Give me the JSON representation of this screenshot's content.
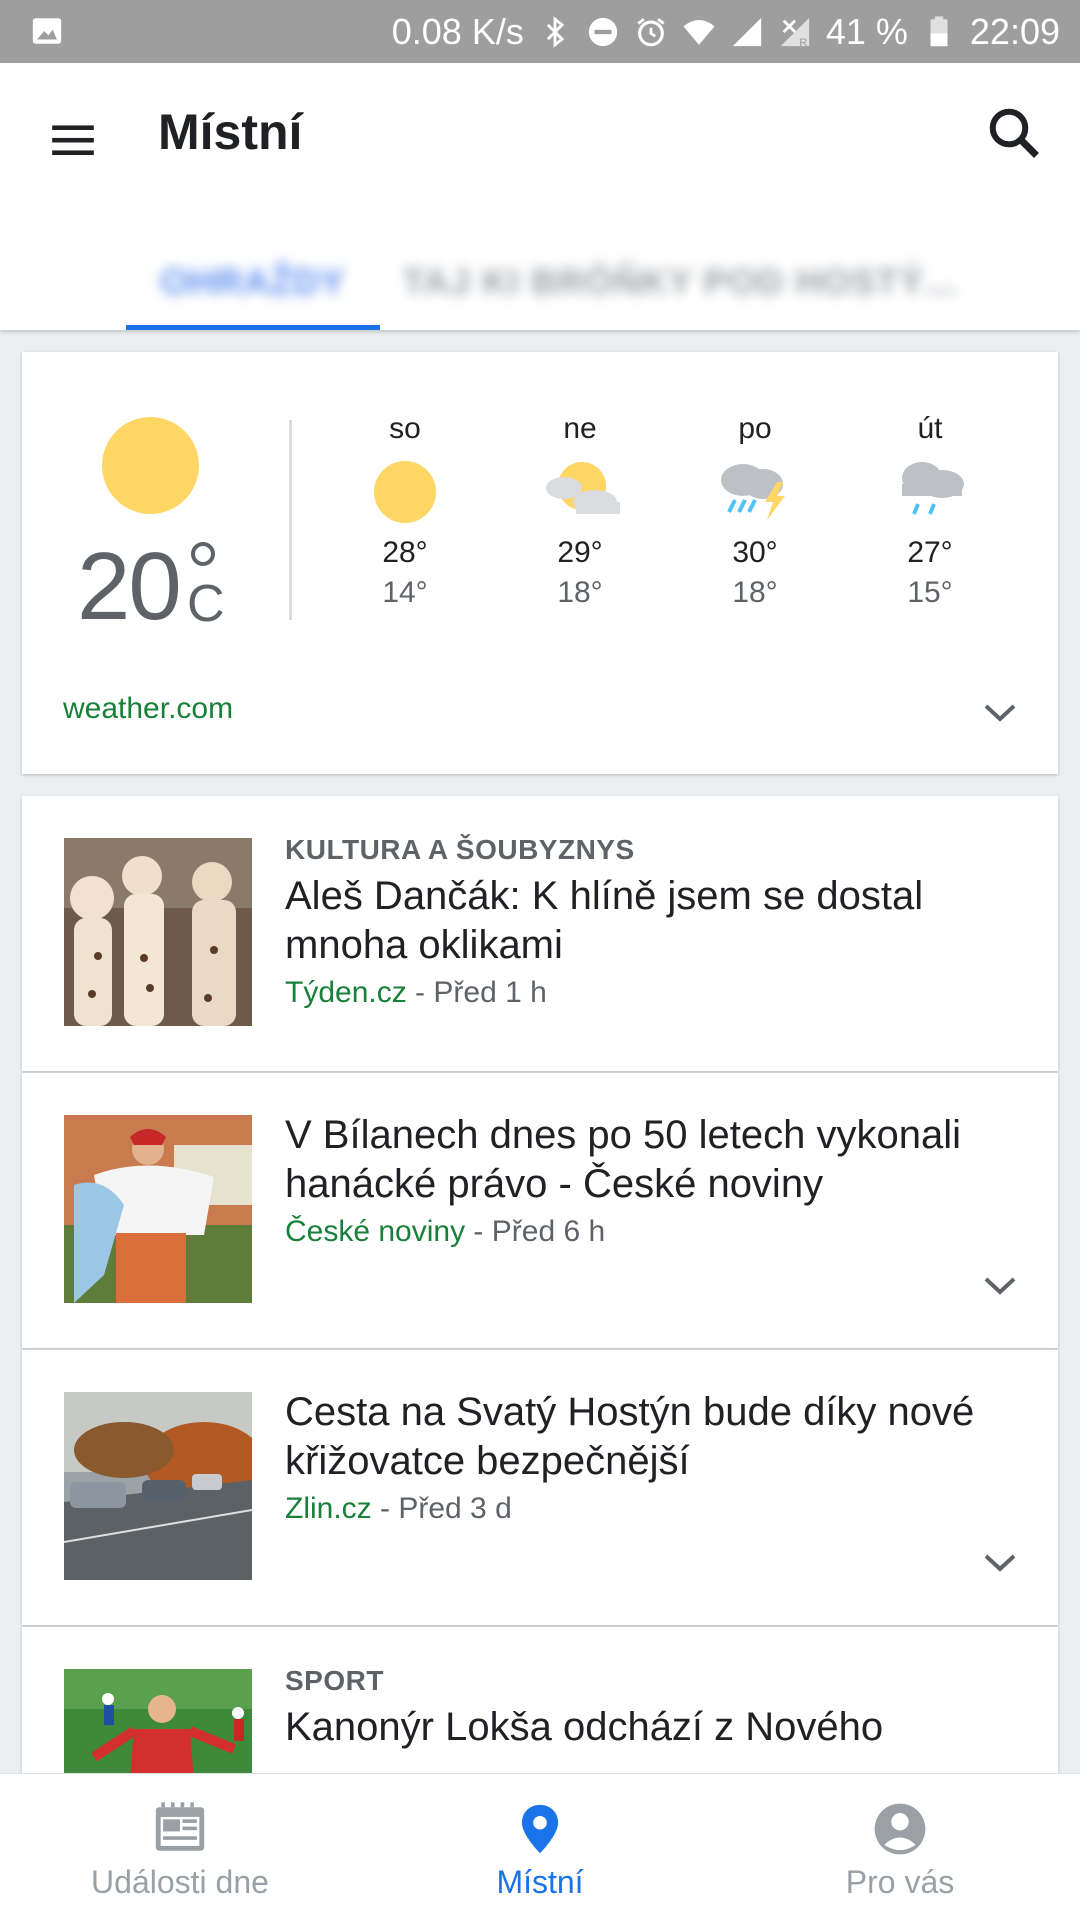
{
  "status_bar": {
    "speed": "0.08 K/s",
    "battery": "41 %",
    "time": "22:09",
    "icons": [
      "image-icon",
      "bluetooth-icon",
      "do-not-disturb-icon",
      "alarm-icon",
      "wifi-icon",
      "signal-icon",
      "signal-roaming-icon",
      "battery-icon"
    ]
  },
  "app_bar": {
    "title": "Místní",
    "tabs": [
      {
        "label": "OHRAŽDY",
        "selected": true
      },
      {
        "label": "TAJ KI BRÖŇKY POD HOSTÝ...",
        "selected": false
      }
    ]
  },
  "weather": {
    "current_temp": "20",
    "unit": "C",
    "current_icon": "sun-icon",
    "forecast": [
      {
        "day": "so",
        "icon": "sun-icon",
        "high": "28°",
        "low": "14°"
      },
      {
        "day": "ne",
        "icon": "partly-cloudy-icon",
        "high": "29°",
        "low": "18°"
      },
      {
        "day": "po",
        "icon": "thunderstorm-icon",
        "high": "30°",
        "low": "18°"
      },
      {
        "day": "út",
        "icon": "rain-icon",
        "high": "27°",
        "low": "15°"
      }
    ],
    "source": "weather.com"
  },
  "news": [
    {
      "category": "KULTURA A ŠOUBYZNYS",
      "title": "Aleš Dančák: K hlíně jsem se dostal mnoha oklikami",
      "source": "Týden.cz",
      "time": " - Před 1 h"
    },
    {
      "category": "",
      "title": "V Bílanech dnes po 50 letech vykonali hanácké právo - České noviny",
      "source": "České noviny",
      "time": " - Před 6 h"
    },
    {
      "category": "",
      "title": "Cesta na Svatý Hostýn bude díky nové křižovatce bezpečnější",
      "source": "Zlin.cz",
      "time": " - Před 3 d"
    },
    {
      "category": "SPORT",
      "title": "Kanonýr Lokša odchází z Nového",
      "source": "",
      "time": ""
    }
  ],
  "bottom_nav": [
    {
      "label": "Události dne",
      "icon": "newspaper-icon",
      "active": false
    },
    {
      "label": "Místní",
      "icon": "location-pin-icon",
      "active": true
    },
    {
      "label": "Pro vás",
      "icon": "account-icon",
      "active": false
    }
  ],
  "colors": {
    "accent": "#1a73e8",
    "source_green": "#188038",
    "sun": "#fdd663",
    "status_bar": "#9e9e9e"
  }
}
